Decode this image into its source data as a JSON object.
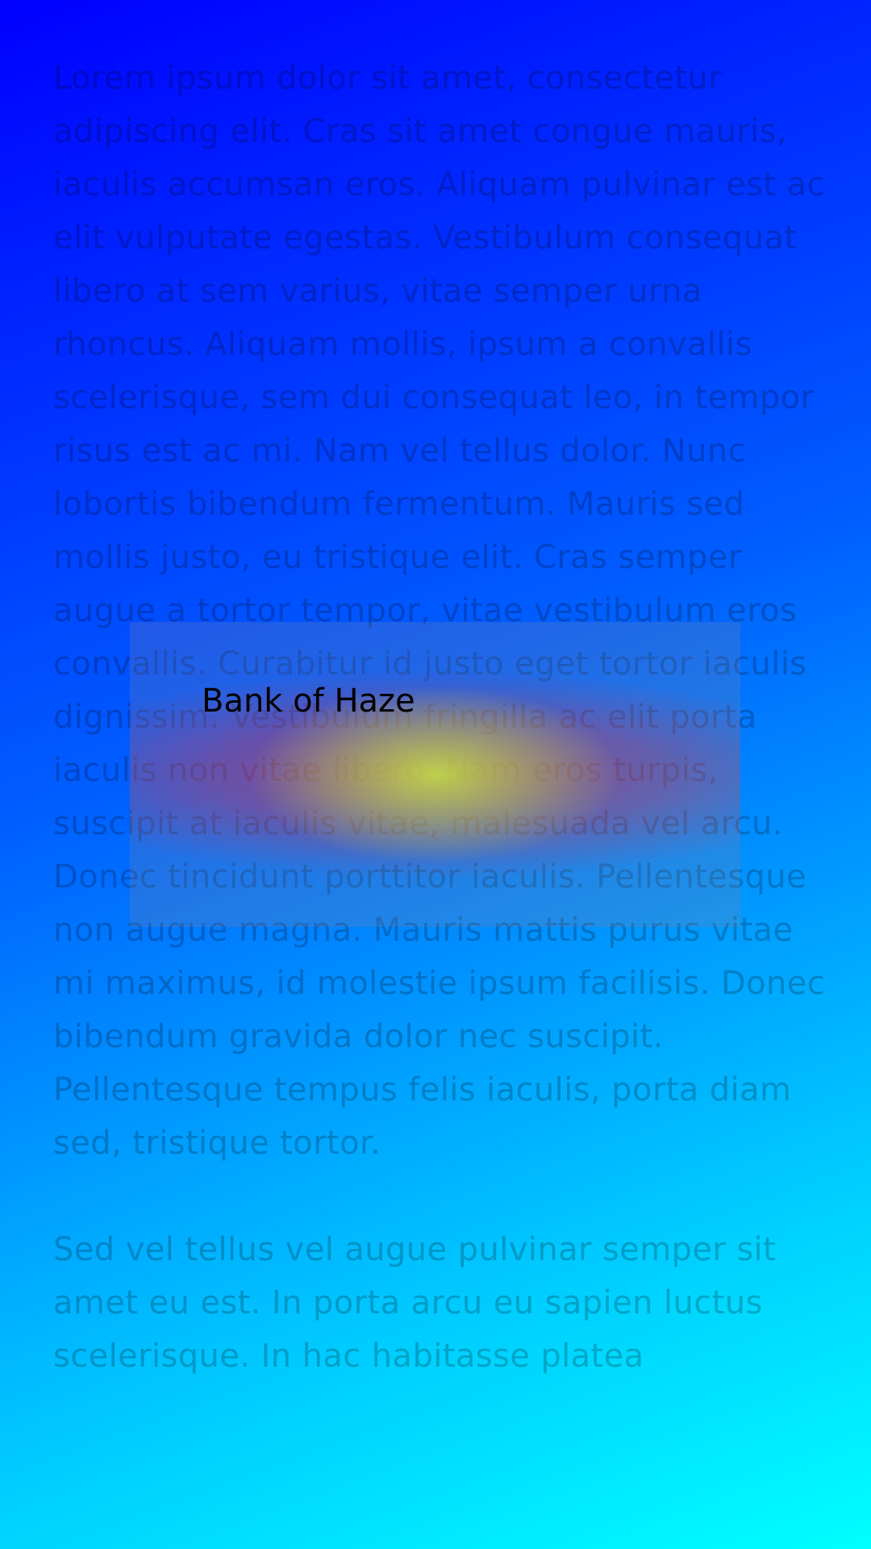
{
  "article": {
    "paragraphs": [
      "Lorem ipsum dolor sit amet, consectetur adipiscing elit. Cras sit amet congue mauris, iaculis accumsan eros. Aliquam pulvinar est ac elit vulputate egestas. Vestibulum consequat libero at sem varius, vitae semper urna rhoncus. Aliquam mollis, ipsum a convallis scelerisque, sem dui consequat leo, in tempor risus est ac mi. Nam vel tellus dolor. Nunc lobortis bibendum fermentum. Mauris sed mollis justo, eu tristique elit. Cras semper augue a tortor tempor, vitae vestibulum eros convallis. Curabitur id justo eget tortor iaculis dignissim. Vestibulum fringilla ac elit porta iaculis non vitae libero. Nam eros turpis, suscipit at iaculis vitae, malesuada vel arcu. Donec tincidunt porttitor iaculis. Pellentesque non augue magna. Mauris mattis purus vitae mi maximus, id molestie ipsum facilisis. Donec bibendum gravida dolor nec suscipit. Pellentesque tempus felis iaculis, porta diam sed, tristique tortor.",
      "Sed vel tellus vel augue pulvinar semper sit amet eu est. In porta arcu eu sapien luctus scelerisque. In hac habitasse platea"
    ]
  },
  "haze_card": {
    "title": "Bank of Haze"
  },
  "colors": {
    "background_top": "#0000ff",
    "background_bottom": "#00ffff",
    "haze_center": "#c8ff3c",
    "haze_band": "#ff1e28"
  }
}
